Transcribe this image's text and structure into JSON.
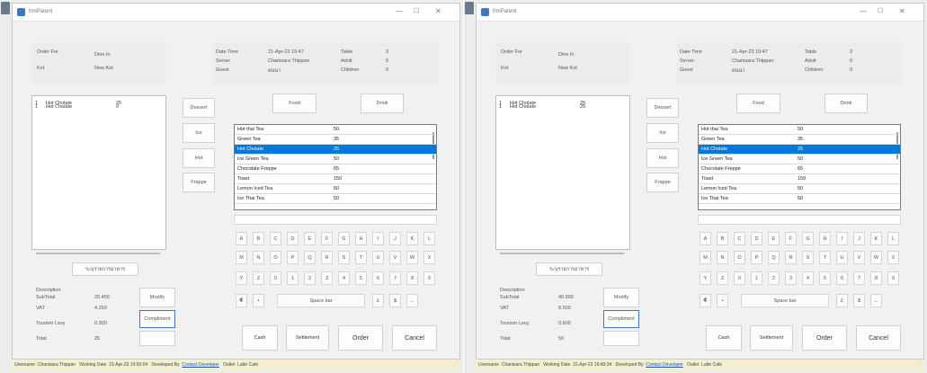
{
  "window": {
    "title": "frmParent",
    "minimize": "—",
    "maximize": "☐",
    "close": "✕"
  },
  "info": {
    "order_for_label": "Order For",
    "order_for_value": "Dine In",
    "kot_label": "Kot",
    "kot_value": "New Kot",
    "datetime_label": "Date Time",
    "datetime_value": "21-Apr-23 19:47",
    "server_label": "Server",
    "server_value": "Chanisara Thippan",
    "guest_label": "Guest",
    "guest_value": "คนนา",
    "table_label": "Table",
    "table_value": "3",
    "adult_label": "Adult",
    "adult_value": "6",
    "children_label": "Children",
    "children_value": "0"
  },
  "categories": [
    "Dessert",
    "Ice",
    "Hot",
    "Frappe"
  ],
  "type_tabs": [
    "Food",
    "Drink"
  ],
  "menu_items": [
    {
      "name": "Hot thai Tea",
      "price": "50"
    },
    {
      "name": "Green Tea",
      "price": "35"
    },
    {
      "name": "Hot Cholate",
      "price": "25"
    },
    {
      "name": "Ice Green Tea",
      "price": "50"
    },
    {
      "name": "Chocolate Freppe",
      "price": "65"
    },
    {
      "name": "Toast",
      "price": "150"
    },
    {
      "name": "Lemon Iced Tea",
      "price": "50"
    },
    {
      "name": "Ice Thai Tea",
      "price": "50"
    }
  ],
  "keyboard": {
    "row1": [
      "A",
      "B",
      "C",
      "D",
      "E",
      "F",
      "G",
      "H",
      "I",
      "J",
      "K",
      "L"
    ],
    "row2": [
      "M",
      "N",
      "O",
      "P",
      "Q",
      "R",
      "S",
      "T",
      "U",
      "V",
      "W",
      "X"
    ],
    "row3": [
      "Y",
      "Z",
      "0",
      "1",
      "2",
      "3",
      "4",
      "5",
      "6",
      "7",
      "8",
      "9"
    ],
    "row4_left": [
      "¢",
      "•"
    ],
    "space": "Space bar",
    "row4_right": [
      "£",
      "$",
      "←"
    ]
  },
  "note_button": "ระบุรายการอาหาร",
  "summary": {
    "description_label": "Description",
    "subtotal_label": "SubTotal",
    "vat_label": "VAT",
    "tourism_label": "Tourism Levy",
    "total_label": "Total"
  },
  "side_buttons": {
    "modify": "Modify",
    "compliment": "Compliment"
  },
  "action_buttons": {
    "cash": "Cash",
    "settlement": "Settlement",
    "order": "Order",
    "cancel": "Cancel"
  },
  "screens": [
    {
      "order_items": [
        {
          "qty": "1",
          "name": "Hot Cholate",
          "price": "25",
          "italic": false
        },
        {
          "qty": "1",
          "name": "Hot Cholate",
          "price": "0",
          "italic": true
        }
      ],
      "subtotal": "20.450",
      "vat": "4.250",
      "tourism": "0.300",
      "total": "25",
      "status_time": "21-Apr-23 19:50:04"
    },
    {
      "order_items": [
        {
          "qty": "1",
          "name": "Hot Cholate",
          "price": "25",
          "italic": false
        },
        {
          "qty": "1",
          "name": "Hot Cholate",
          "price": "25",
          "italic": false
        }
      ],
      "subtotal": "40.900",
      "vat": "8.500",
      "tourism": "0.600",
      "total": "50",
      "status_time": "21-Apr-23 19:49:34"
    }
  ],
  "status": {
    "username_label": "Username",
    "username": "Chanisara Thippan",
    "working_date_label": "Working Date",
    "developed_by_label": "Developed By",
    "contact_link": "Contact Developer",
    "outlet_label": "Outlet",
    "outlet": "Latte Cafe"
  },
  "colors": {
    "selection": "#0078d7",
    "statusbar": "#f3efd2",
    "link": "#1a4fb5"
  }
}
